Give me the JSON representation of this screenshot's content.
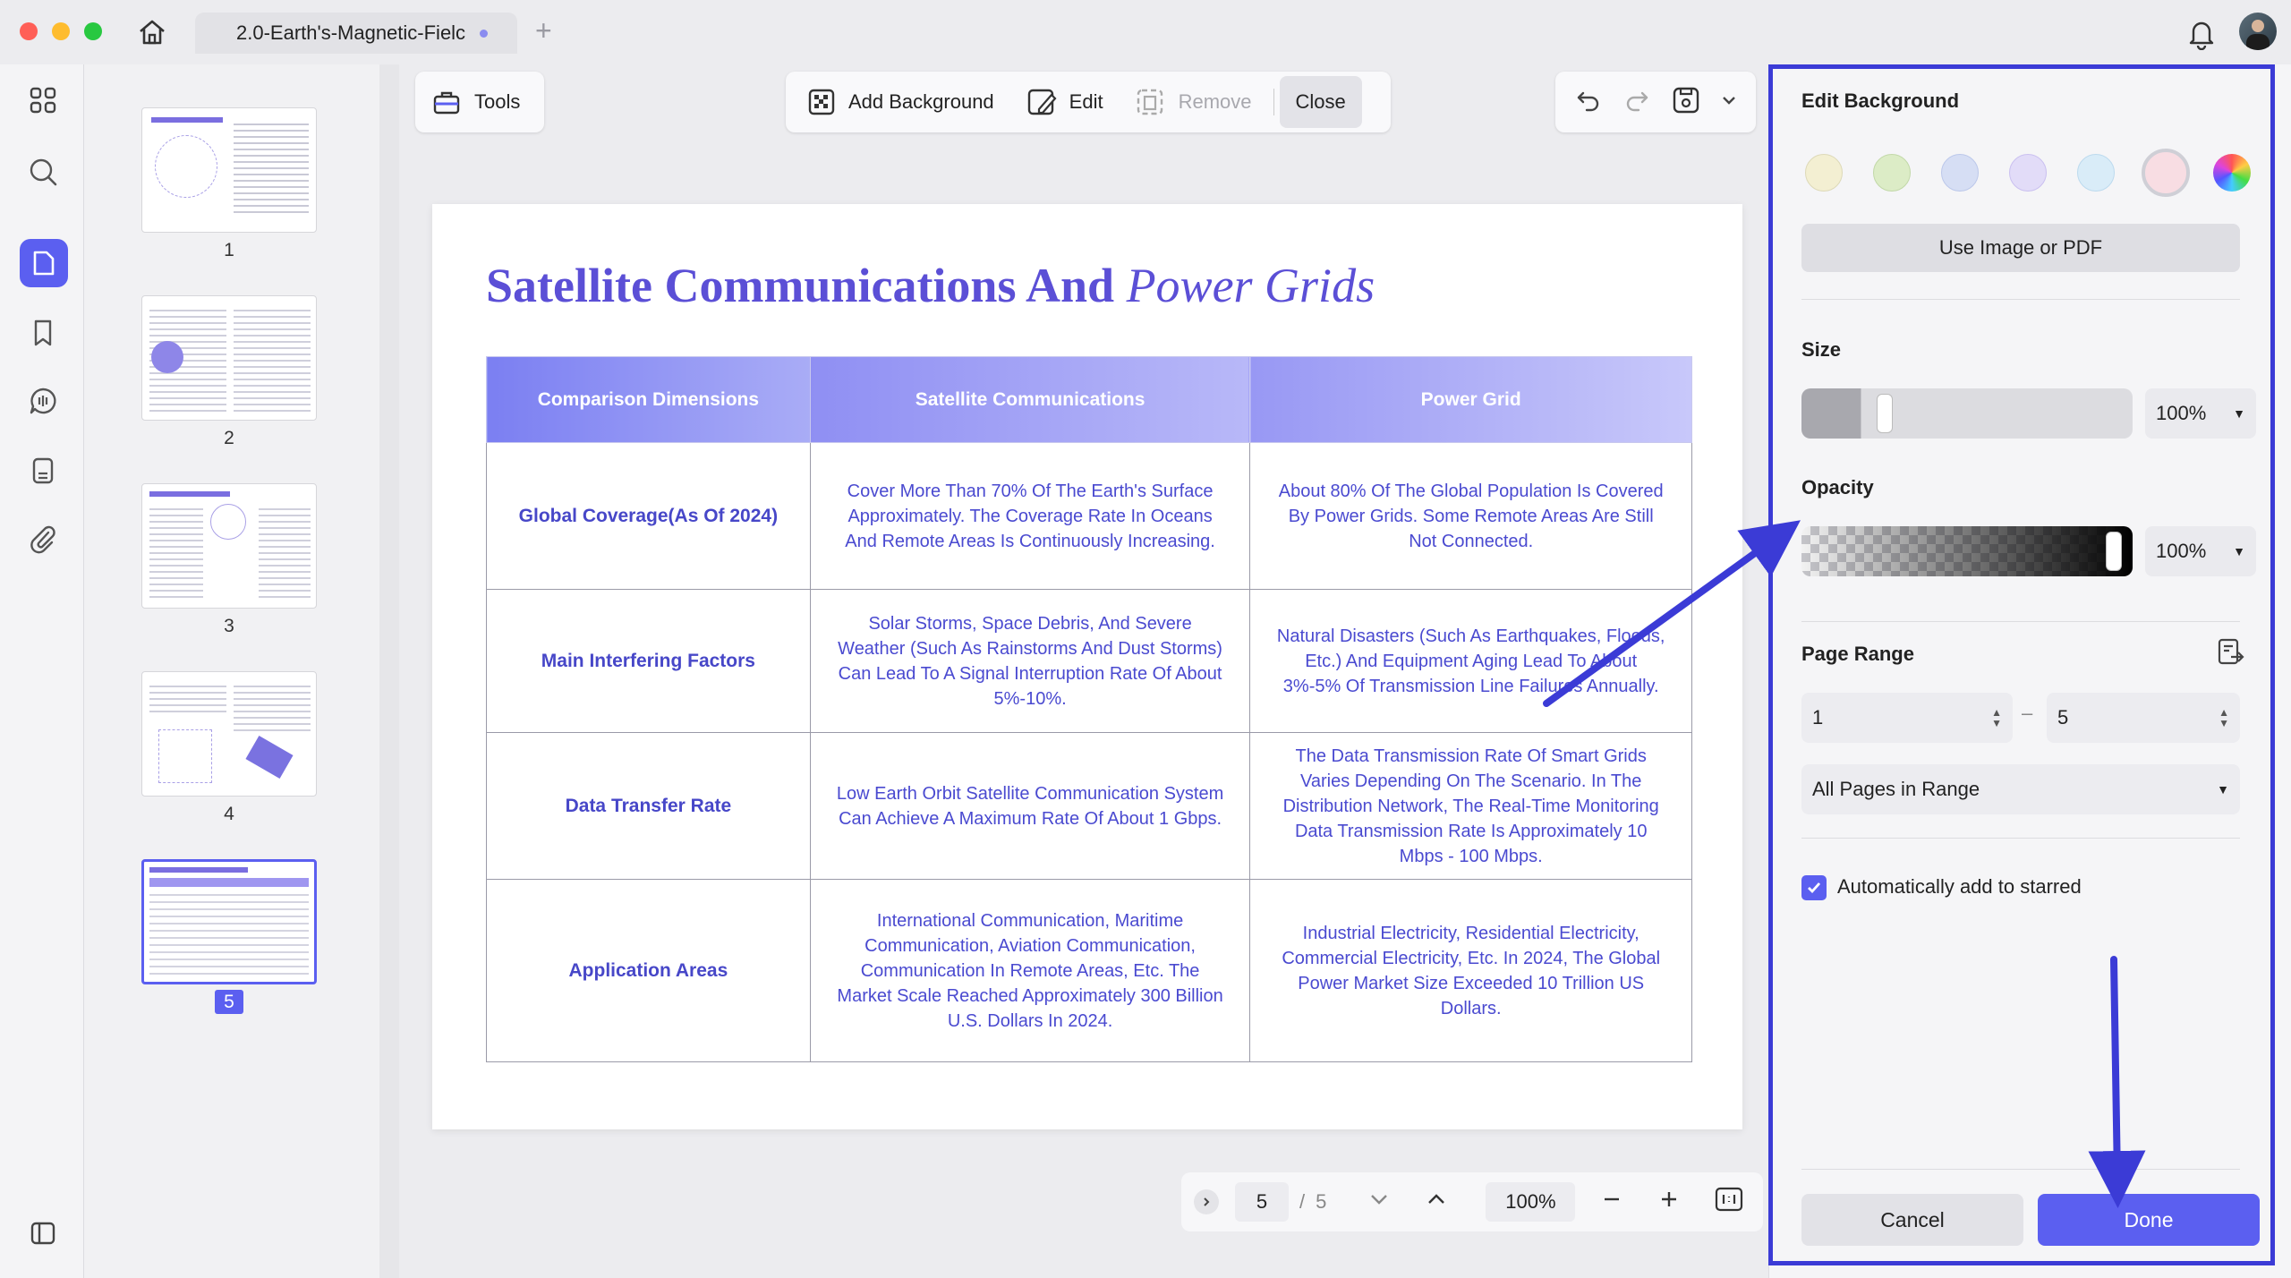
{
  "window": {
    "tab_title": "2.0-Earth's-Magnetic-Fielc",
    "new_tab": "+"
  },
  "sidebar": {
    "icons": [
      "grid-icon",
      "search-icon",
      "page-icon",
      "bookmark-icon",
      "comment-icon",
      "form-icon",
      "attachment-icon",
      "sidebar-toggle-icon"
    ]
  },
  "thumbnails": {
    "pages": [
      "1",
      "2",
      "3",
      "4",
      "5"
    ],
    "selected": "5"
  },
  "toolbar": {
    "tools": "Tools",
    "add_background": "Add Background",
    "edit": "Edit",
    "remove": "Remove",
    "close": "Close"
  },
  "document": {
    "title_bold": "Satellite Communications And ",
    "title_italic": "Power Grids",
    "headers": [
      "Comparison Dimensions",
      "Satellite Communications",
      "Power Grid"
    ],
    "rows": [
      [
        "Global Coverage(As Of 2024)",
        "Cover More Than 70% Of The Earth's Surface Approximately. The Coverage Rate In Oceans And Remote Areas Is Continuously Increasing.",
        "About 80% Of The Global Population Is Covered By Power Grids. Some Remote Areas Are Still Not Connected."
      ],
      [
        "Main Interfering Factors",
        "Solar Storms, Space Debris, And Severe Weather (Such As Rainstorms And Dust Storms) Can Lead To A Signal Interruption Rate Of About 5%-10%.",
        "Natural Disasters (Such As Earthquakes, Floods, Etc.) And Equipment Aging Lead To About 3%-5% Of Transmission Line Failures Annually."
      ],
      [
        "Data Transfer Rate",
        "Low Earth Orbit Satellite Communication System Can Achieve A Maximum Rate Of About 1 Gbps.",
        "The Data Transmission Rate Of Smart Grids Varies Depending On The Scenario. In The Distribution Network, The Real-Time Monitoring Data Transmission Rate Is Approximately 10 Mbps - 100 Mbps."
      ],
      [
        "Application Areas",
        "International Communication, Maritime Communication, Aviation Communication, Communication In Remote Areas, Etc. The Market Scale Reached Approximately 300 Billion U.S. Dollars In 2024.",
        "Industrial Electricity, Residential Electricity, Commercial Electricity, Etc. In 2024, The Global Power Market Size Exceeded 10 Trillion US Dollars."
      ]
    ]
  },
  "pagenav": {
    "current": "5",
    "separator": "/",
    "total": "5",
    "zoom": "100%"
  },
  "panel": {
    "title": "Edit Background",
    "swatches": [
      "#f3efd2",
      "#dcecc6",
      "#d6def4",
      "#e2dcf8",
      "#d9ecf8",
      "#f8dde3",
      "rainbow"
    ],
    "use_image": "Use Image or PDF",
    "size_label": "Size",
    "size_value": "100%",
    "opacity_label": "Opacity",
    "opacity_value": "100%",
    "range_label": "Page Range",
    "range_from": "1",
    "range_dash": "–",
    "range_to": "5",
    "range_mode": "All Pages in Range",
    "auto_star": "Automatically add to starred",
    "cancel": "Cancel",
    "done": "Done"
  },
  "colors": {
    "accent": "#5b5ff0",
    "annotation": "#3b3bd6",
    "doc_text": "#4a4ad0"
  }
}
